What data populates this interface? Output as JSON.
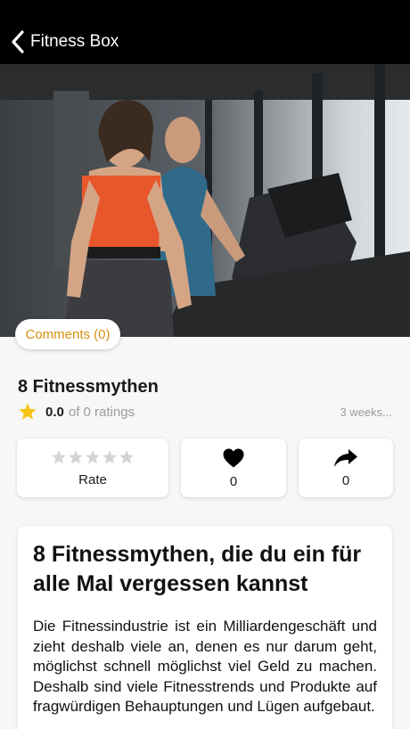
{
  "nav": {
    "back_label": "Fitness Box"
  },
  "hero": {
    "image": "gym-treadmill-photo"
  },
  "comments": {
    "label": "Comments (0)"
  },
  "article": {
    "title": "8 Fitnessmythen",
    "rating_value": "0.0",
    "rating_text": "of 0 ratings",
    "timestamp": "3 weeks...",
    "heading": "8 Fitnessmythen, die du ein für alle Mal vergessen kannst",
    "body": "Die Fitnessindustrie ist ein Milliardengeschäft und zieht deshalb viele an, denen es nur darum geht, möglichst schnell möglichst viel Geld zu machen. Deshalb sind viele Fitnesstrends und Produkte auf fragwürdigen Behauptungen und Lügen aufgebaut."
  },
  "actions": {
    "rate_label": "Rate",
    "like_count": "0",
    "share_count": "0"
  },
  "icons": {
    "back": "chevron-left-icon",
    "star": "star-icon",
    "heart": "heart-icon",
    "share": "share-arrow-icon"
  },
  "colors": {
    "accent": "#d98f10",
    "star_filled": "#f5c518",
    "star_empty": "#d4d4d4",
    "navbar": "#000000"
  }
}
